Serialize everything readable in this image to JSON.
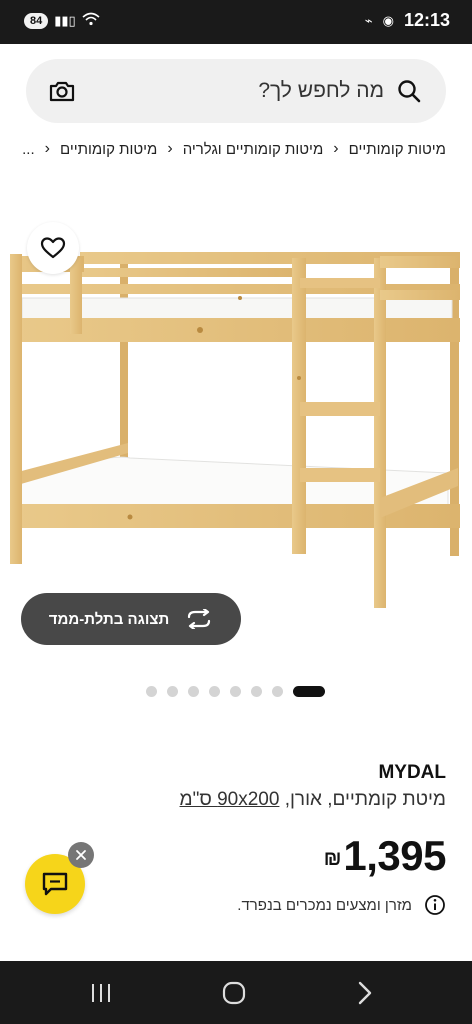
{
  "status_bar": {
    "battery": "84",
    "time": "12:13",
    "wifi_label": "5"
  },
  "search": {
    "placeholder": "מה לחפש לך?"
  },
  "breadcrumb": {
    "items": [
      "...",
      "מיטות קומותיים וגלריה",
      "מיטות קומותיים"
    ],
    "first_link": "מיטות קומותיים"
  },
  "product": {
    "view_3d_label": "תצוגה בתלת-ממד",
    "dots_count": 8,
    "active_dot": 7,
    "name": "MYDAL",
    "description_prefix": "מיטת קומתיים, אורן, ",
    "description_size": "90x200 ס\"מ",
    "price": "1,395",
    "currency": "₪",
    "note": "מזרן ומצעים נמכרים בנפרד."
  },
  "colors": {
    "accent": "#f6d51a",
    "pine": "#e8c684",
    "pine_dark": "#c99a4a"
  },
  "icons": {
    "search": "search-icon",
    "camera": "camera-icon",
    "heart": "heart-icon",
    "rotate": "rotate-3d-icon",
    "info": "info-icon",
    "chat": "chat-icon",
    "close": "close-icon"
  }
}
